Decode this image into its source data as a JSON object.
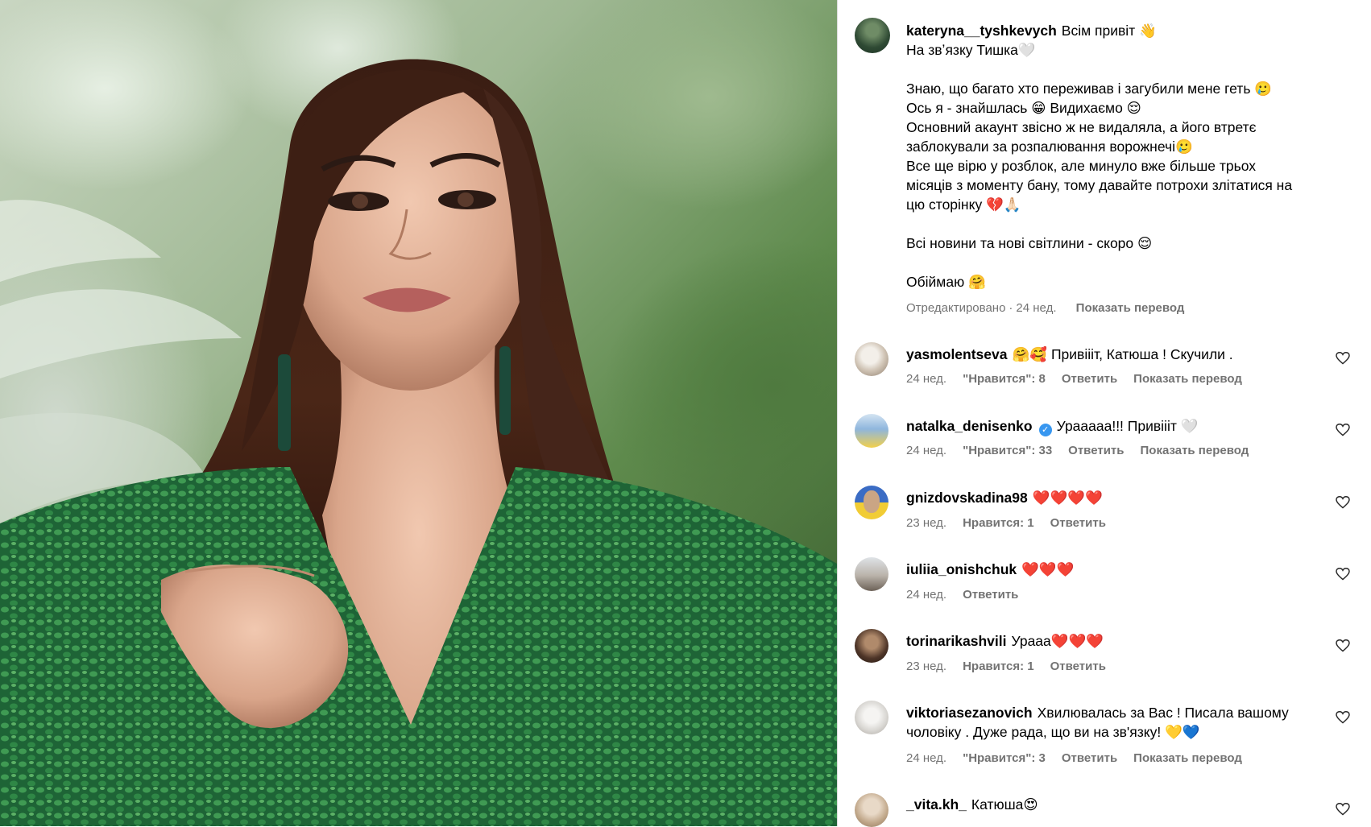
{
  "post": {
    "author": "kateryna__tyshkevych",
    "caption_lines": [
      "Всім привіт 👋",
      "На звʼязку Тишка🤍",
      "",
      "Знаю, що багато хто переживав і загубили мене геть 🥲",
      "Ось я - знайшлась 😁 Видихаємо 😌",
      "Основний акаунт звісно ж не видаляла, а його втретє",
      "заблокували за розпалювання ворожнечі🥲",
      "Все ще вірю у розблок, але минуло вже більше трьох",
      "місяців з моменту бану, тому давайте потрохи злітатися на",
      "цю сторінку 💔🙏🏻",
      "",
      "Всі новини та нові світлини - скоро 😌",
      "",
      "Обіймаю 🤗"
    ],
    "edited_label": "Отредактировано",
    "time": "24 нед.",
    "translate_label": "Показать перевод"
  },
  "comments": [
    {
      "user": "yasmolentseva",
      "verified": false,
      "text_lines": [
        "🤗🥰 Привіііт, Катюша ! Скучили ."
      ],
      "time": "24 нед.",
      "likes": "\"Нравится\": 8",
      "reply": "Ответить",
      "translate": "Показать перевод"
    },
    {
      "user": "natalka_denisenko",
      "verified": true,
      "text_lines": [
        "Урааааа!!! Привіііт 🤍"
      ],
      "time": "24 нед.",
      "likes": "\"Нравится\": 33",
      "reply": "Ответить",
      "translate": "Показать перевод"
    },
    {
      "user": "gnizdovskadina98",
      "verified": false,
      "text_lines": [
        "❤️❤️❤️❤️"
      ],
      "time": "23 нед.",
      "likes": "Нравится: 1",
      "reply": "Ответить",
      "translate": ""
    },
    {
      "user": "iuliia_onishchuk",
      "verified": false,
      "text_lines": [
        "❤️❤️❤️"
      ],
      "time": "24 нед.",
      "likes": "",
      "reply": "Ответить",
      "translate": ""
    },
    {
      "user": "torinarikashvili",
      "verified": false,
      "text_lines": [
        "Урааа❤️❤️❤️"
      ],
      "time": "23 нед.",
      "likes": "Нравится: 1",
      "reply": "Ответить",
      "translate": ""
    },
    {
      "user": "viktoriasezanovich",
      "verified": false,
      "text_lines": [
        "Хвилювалась за Вас ! Писала вашому",
        "чоловіку . Дуже рада, що ви на зв'язку! 💛💙"
      ],
      "time": "24 нед.",
      "likes": "\"Нравится\": 3",
      "reply": "Ответить",
      "translate": "Показать перевод"
    },
    {
      "user": "_vita.kh_",
      "verified": false,
      "text_lines": [
        "Катюша😍"
      ],
      "time": "",
      "likes": "",
      "reply": "",
      "translate": ""
    }
  ],
  "colors": {
    "meta_text": "#737373",
    "verified_badge": "#3897f0",
    "dress": "#1f6b3a"
  },
  "icons": {
    "like": "heart-outline-icon",
    "verified": "verified-badge-icon"
  }
}
